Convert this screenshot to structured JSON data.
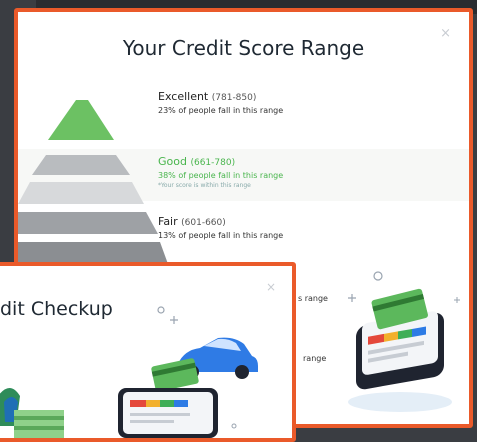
{
  "range_modal": {
    "title": "Your Credit Score Range",
    "close": "×",
    "rows": [
      {
        "name": "Excellent",
        "range": "(781-850)",
        "pct": "23% of people fall in this range"
      },
      {
        "name": "Good",
        "range": "(661-780)",
        "pct": "38% of people fall in this range",
        "note": "*Your score is within this range"
      },
      {
        "name": "Fair",
        "range": "(601-660)",
        "pct": "13% of people fall in this range"
      }
    ],
    "trailing_1": "s range",
    "trailing_2": "range"
  },
  "checkup_modal": {
    "title": "dit Checkup",
    "close": "×"
  },
  "colors": {
    "accent": "#ea5a2a",
    "good": "#49b54d",
    "excellent": "#6cc163"
  }
}
